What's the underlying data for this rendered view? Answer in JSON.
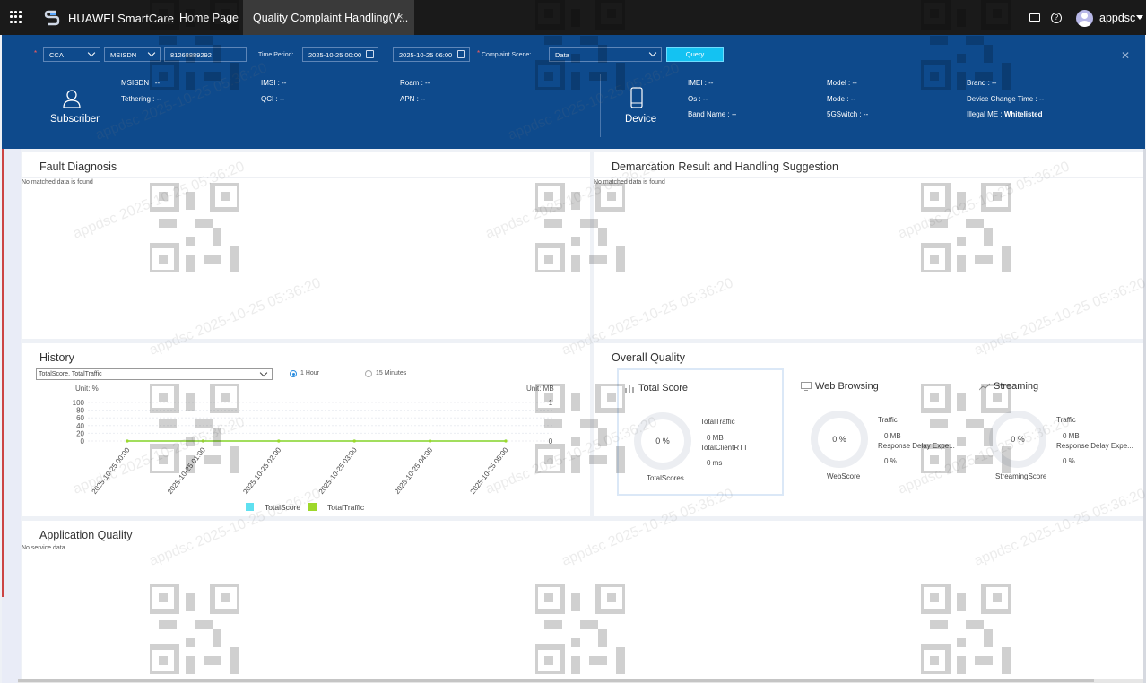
{
  "app": {
    "brand": "HUAWEI SmartCare",
    "tabs": [
      {
        "label": "Home Page"
      },
      {
        "label": "Quality Complaint Handling(V...",
        "close": "×"
      }
    ],
    "user": "appdsc"
  },
  "filters": {
    "type_value": "CCA",
    "id_type_value": "MSISDN",
    "msisdn_value": "81268889292",
    "time_period_label": "Time Period:",
    "start_time": "2025-10-25 00:00",
    "end_time": "2025-10-25 06:00",
    "scene_label": "Complaint Scene:",
    "scene_value": "Data",
    "query_label": "Query",
    "required_mark": "*"
  },
  "subscriber": {
    "label": "Subscriber",
    "fields": [
      {
        "k": "MSISDN :",
        "v": "--"
      },
      {
        "k": "IMSI :",
        "v": "--"
      },
      {
        "k": "Roam :",
        "v": "--"
      },
      {
        "k": "Tethering :",
        "v": "--"
      },
      {
        "k": "QCI :",
        "v": "--"
      },
      {
        "k": "APN :",
        "v": "--"
      }
    ]
  },
  "device": {
    "label": "Device",
    "fields": [
      {
        "k": "IMEI :",
        "v": "--"
      },
      {
        "k": "Model :",
        "v": "--"
      },
      {
        "k": "Brand :",
        "v": "--"
      },
      {
        "k": "Os :",
        "v": "--"
      },
      {
        "k": "Mode :",
        "v": "--"
      },
      {
        "k": "Device Change Time :",
        "v": "--"
      },
      {
        "k": "Band Name :",
        "v": "--"
      },
      {
        "k": "5GSwitch :",
        "v": "--"
      },
      {
        "k": "Illegal ME :",
        "v": "Whitelisted"
      }
    ]
  },
  "fault": {
    "title": "Fault Diagnosis",
    "empty": "No matched data is found"
  },
  "demarcation": {
    "title": "Demarcation Result and Handling Suggestion",
    "empty": "No matched data is found"
  },
  "history": {
    "title": "History",
    "select_value": "TotalScore, TotalTraffic",
    "radio_1h": "1 Hour",
    "radio_15m": "15 Minutes",
    "selected_radio": "1 Hour"
  },
  "chart_data": {
    "type": "line",
    "x": [
      "2025-10-25 00:00",
      "2025-10-25 01:00",
      "2025-10-25 02:00",
      "2025-10-25 03:00",
      "2025-10-25 04:00",
      "2025-10-25 05:00"
    ],
    "series": [
      {
        "name": "TotalScore",
        "values": [
          0,
          0,
          0,
          0,
          0,
          0
        ],
        "color": "#5fe0f0",
        "axis": "left"
      },
      {
        "name": "TotalTraffic",
        "values": [
          0,
          0,
          0,
          0,
          0,
          0
        ],
        "color": "#9ed82a",
        "axis": "right"
      }
    ],
    "ylabel": "Unit: %",
    "y2label": "Unit: MB",
    "ylim": [
      0,
      100
    ],
    "yticks": [
      0,
      20,
      40,
      60,
      80,
      100
    ],
    "y2lim": [
      0,
      1
    ],
    "y2ticks": [
      0,
      1
    ],
    "legend": "bottom",
    "grid": true
  },
  "overall": {
    "title": "Overall Quality",
    "cards": [
      {
        "title": "Total Score",
        "pct": "0 %",
        "caption": "TotalScores",
        "m1": "TotalTraffic",
        "v1": "0 MB",
        "m2": "TotalClientRTT",
        "v2": "0 ms"
      },
      {
        "title": "Web Browsing",
        "pct": "0 %",
        "caption": "WebScore",
        "m1": "Traffic",
        "v1": "0 MB",
        "m2": "Response Delay Expe...",
        "v2": "0 %"
      },
      {
        "title": "Streaming",
        "pct": "0 %",
        "caption": "StreamingScore",
        "m1": "Traffic",
        "v1": "0 MB",
        "m2": "Response Delay Expe...",
        "v2": "0 %"
      }
    ]
  },
  "appq": {
    "title": "Application Quality",
    "empty": "No service data"
  },
  "watermark": "appdsc 2025-10-25 05:36:20",
  "colors": {
    "topbar": "#1a1a1a",
    "header": "#0e4a8c",
    "query": "#14c2f2"
  }
}
